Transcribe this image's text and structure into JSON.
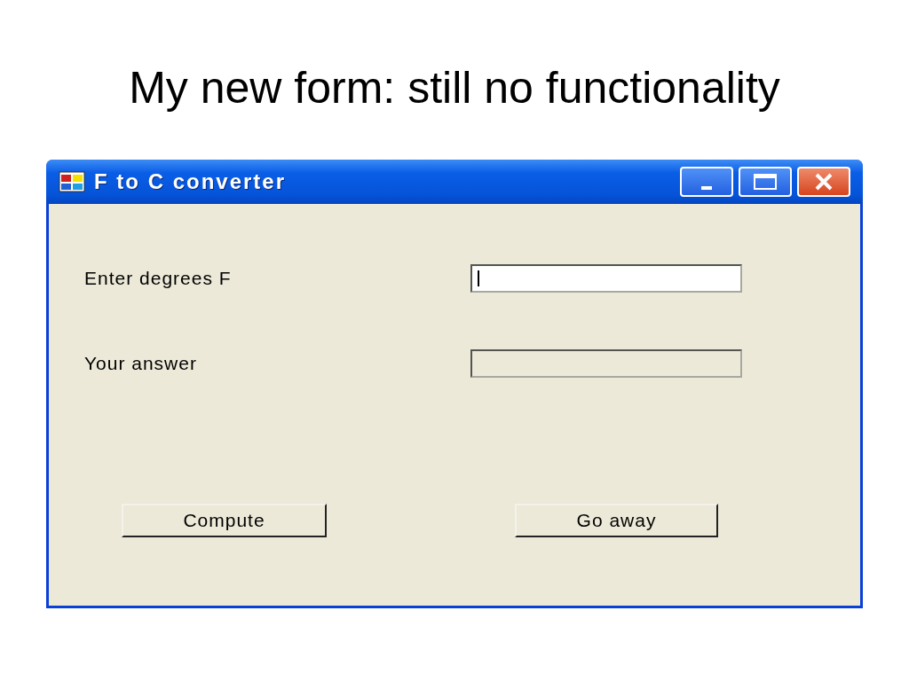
{
  "slide": {
    "title": "My new form: still no functionality"
  },
  "window": {
    "title": "F to C converter"
  },
  "fields": [
    {
      "label": "Enter degrees F",
      "focused": true,
      "disabled": false
    },
    {
      "label": "Your answer",
      "focused": false,
      "disabled": true
    }
  ],
  "buttons": [
    "Compute",
    "Go away"
  ]
}
